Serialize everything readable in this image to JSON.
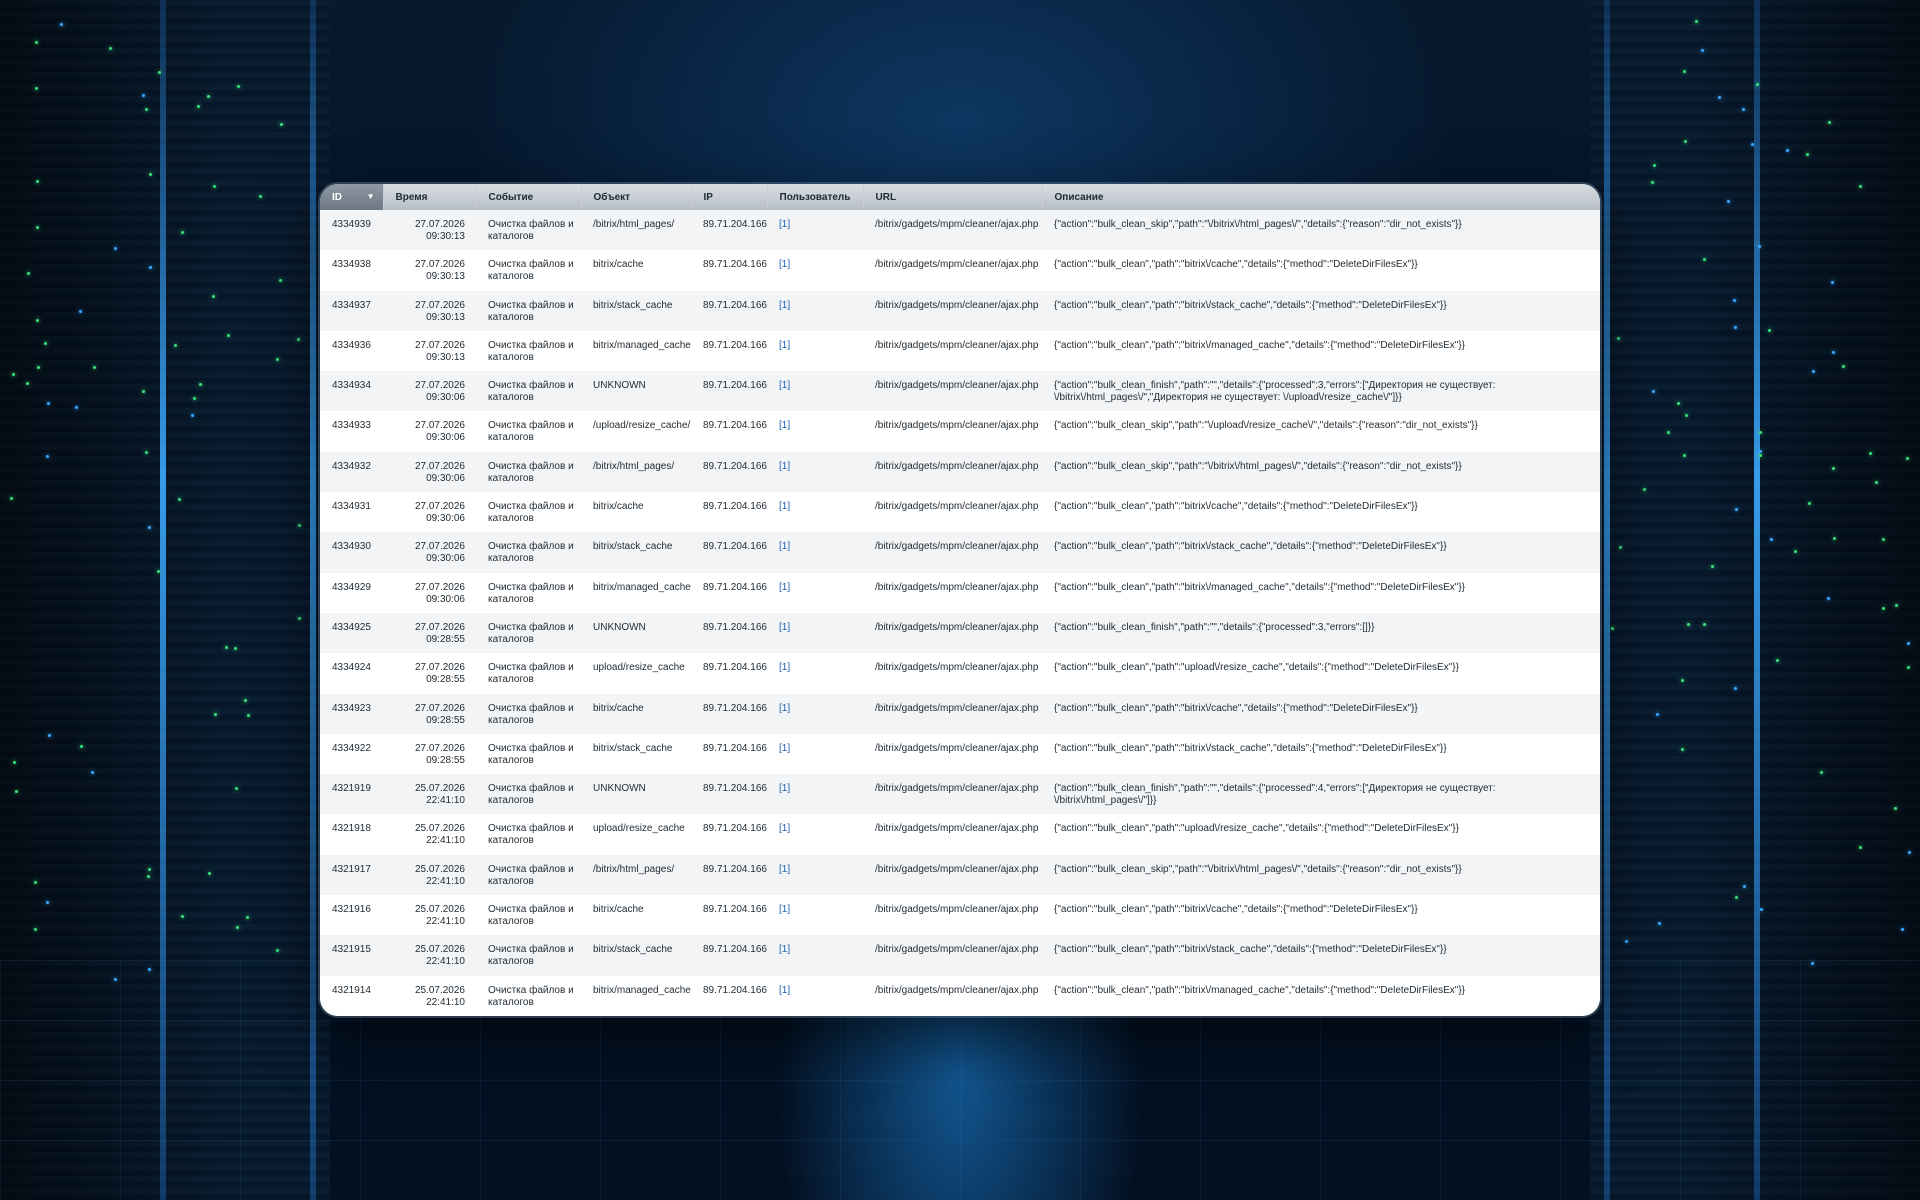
{
  "table": {
    "columns": [
      {
        "key": "id",
        "label": "ID",
        "sorted": true
      },
      {
        "key": "time",
        "label": "Время"
      },
      {
        "key": "event",
        "label": "Событие"
      },
      {
        "key": "object",
        "label": "Объект"
      },
      {
        "key": "ip",
        "label": "IP"
      },
      {
        "key": "user",
        "label": "Пользователь"
      },
      {
        "key": "url",
        "label": "URL"
      },
      {
        "key": "desc",
        "label": "Описание"
      }
    ],
    "sort_icon": "sort-desc-icon",
    "rows": [
      {
        "id": "4334939",
        "date": "27.07.2026",
        "clock": "09:30:13",
        "event": "Очистка файлов и каталогов",
        "object": "/bitrix/html_pages/",
        "ip": "89.71.204.166",
        "user": "[1]",
        "url": "/bitrix/gadgets/mpm/cleaner/ajax.php",
        "desc": "{\"action\":\"bulk_clean_skip\",\"path\":\"\\/bitrix\\/html_pages\\/\",\"details\":{\"reason\":\"dir_not_exists\"}}"
      },
      {
        "id": "4334938",
        "date": "27.07.2026",
        "clock": "09:30:13",
        "event": "Очистка файлов и каталогов",
        "object": "bitrix/cache",
        "ip": "89.71.204.166",
        "user": "[1]",
        "url": "/bitrix/gadgets/mpm/cleaner/ajax.php",
        "desc": "{\"action\":\"bulk_clean\",\"path\":\"bitrix\\/cache\",\"details\":{\"method\":\"DeleteDirFilesEx\"}}"
      },
      {
        "id": "4334937",
        "date": "27.07.2026",
        "clock": "09:30:13",
        "event": "Очистка файлов и каталогов",
        "object": "bitrix/stack_cache",
        "ip": "89.71.204.166",
        "user": "[1]",
        "url": "/bitrix/gadgets/mpm/cleaner/ajax.php",
        "desc": "{\"action\":\"bulk_clean\",\"path\":\"bitrix\\/stack_cache\",\"details\":{\"method\":\"DeleteDirFilesEx\"}}"
      },
      {
        "id": "4334936",
        "date": "27.07.2026",
        "clock": "09:30:13",
        "event": "Очистка файлов и каталогов",
        "object": "bitrix/managed_cache",
        "ip": "89.71.204.166",
        "user": "[1]",
        "url": "/bitrix/gadgets/mpm/cleaner/ajax.php",
        "desc": "{\"action\":\"bulk_clean\",\"path\":\"bitrix\\/managed_cache\",\"details\":{\"method\":\"DeleteDirFilesEx\"}}"
      },
      {
        "id": "4334934",
        "date": "27.07.2026",
        "clock": "09:30:06",
        "event": "Очистка файлов и каталогов",
        "object": "UNKNOWN",
        "ip": "89.71.204.166",
        "user": "[1]",
        "url": "/bitrix/gadgets/mpm/cleaner/ajax.php",
        "desc": "{\"action\":\"bulk_clean_finish\",\"path\":\"\",\"details\":{\"processed\":3,\"errors\":[\"Директория не существует: \\/bitrix\\/html_pages\\/\",\"Директория не существует: \\/upload\\/resize_cache\\/\"]}}"
      },
      {
        "id": "4334933",
        "date": "27.07.2026",
        "clock": "09:30:06",
        "event": "Очистка файлов и каталогов",
        "object": "/upload/resize_cache/",
        "ip": "89.71.204.166",
        "user": "[1]",
        "url": "/bitrix/gadgets/mpm/cleaner/ajax.php",
        "desc": "{\"action\":\"bulk_clean_skip\",\"path\":\"\\/upload\\/resize_cache\\/\",\"details\":{\"reason\":\"dir_not_exists\"}}"
      },
      {
        "id": "4334932",
        "date": "27.07.2026",
        "clock": "09:30:06",
        "event": "Очистка файлов и каталогов",
        "object": "/bitrix/html_pages/",
        "ip": "89.71.204.166",
        "user": "[1]",
        "url": "/bitrix/gadgets/mpm/cleaner/ajax.php",
        "desc": "{\"action\":\"bulk_clean_skip\",\"path\":\"\\/bitrix\\/html_pages\\/\",\"details\":{\"reason\":\"dir_not_exists\"}}"
      },
      {
        "id": "4334931",
        "date": "27.07.2026",
        "clock": "09:30:06",
        "event": "Очистка файлов и каталогов",
        "object": "bitrix/cache",
        "ip": "89.71.204.166",
        "user": "[1]",
        "url": "/bitrix/gadgets/mpm/cleaner/ajax.php",
        "desc": "{\"action\":\"bulk_clean\",\"path\":\"bitrix\\/cache\",\"details\":{\"method\":\"DeleteDirFilesEx\"}}"
      },
      {
        "id": "4334930",
        "date": "27.07.2026",
        "clock": "09:30:06",
        "event": "Очистка файлов и каталогов",
        "object": "bitrix/stack_cache",
        "ip": "89.71.204.166",
        "user": "[1]",
        "url": "/bitrix/gadgets/mpm/cleaner/ajax.php",
        "desc": "{\"action\":\"bulk_clean\",\"path\":\"bitrix\\/stack_cache\",\"details\":{\"method\":\"DeleteDirFilesEx\"}}"
      },
      {
        "id": "4334929",
        "date": "27.07.2026",
        "clock": "09:30:06",
        "event": "Очистка файлов и каталогов",
        "object": "bitrix/managed_cache",
        "ip": "89.71.204.166",
        "user": "[1]",
        "url": "/bitrix/gadgets/mpm/cleaner/ajax.php",
        "desc": "{\"action\":\"bulk_clean\",\"path\":\"bitrix\\/managed_cache\",\"details\":{\"method\":\"DeleteDirFilesEx\"}}"
      },
      {
        "id": "4334925",
        "date": "27.07.2026",
        "clock": "09:28:55",
        "event": "Очистка файлов и каталогов",
        "object": "UNKNOWN",
        "ip": "89.71.204.166",
        "user": "[1]",
        "url": "/bitrix/gadgets/mpm/cleaner/ajax.php",
        "desc": "{\"action\":\"bulk_clean_finish\",\"path\":\"\",\"details\":{\"processed\":3,\"errors\":[]}}"
      },
      {
        "id": "4334924",
        "date": "27.07.2026",
        "clock": "09:28:55",
        "event": "Очистка файлов и каталогов",
        "object": "upload/resize_cache",
        "ip": "89.71.204.166",
        "user": "[1]",
        "url": "/bitrix/gadgets/mpm/cleaner/ajax.php",
        "desc": "{\"action\":\"bulk_clean\",\"path\":\"upload\\/resize_cache\",\"details\":{\"method\":\"DeleteDirFilesEx\"}}"
      },
      {
        "id": "4334923",
        "date": "27.07.2026",
        "clock": "09:28:55",
        "event": "Очистка файлов и каталогов",
        "object": "bitrix/cache",
        "ip": "89.71.204.166",
        "user": "[1]",
        "url": "/bitrix/gadgets/mpm/cleaner/ajax.php",
        "desc": "{\"action\":\"bulk_clean\",\"path\":\"bitrix\\/cache\",\"details\":{\"method\":\"DeleteDirFilesEx\"}}"
      },
      {
        "id": "4334922",
        "date": "27.07.2026",
        "clock": "09:28:55",
        "event": "Очистка файлов и каталогов",
        "object": "bitrix/stack_cache",
        "ip": "89.71.204.166",
        "user": "[1]",
        "url": "/bitrix/gadgets/mpm/cleaner/ajax.php",
        "desc": "{\"action\":\"bulk_clean\",\"path\":\"bitrix\\/stack_cache\",\"details\":{\"method\":\"DeleteDirFilesEx\"}}"
      },
      {
        "id": "4321919",
        "date": "25.07.2026",
        "clock": "22:41:10",
        "event": "Очистка файлов и каталогов",
        "object": "UNKNOWN",
        "ip": "89.71.204.166",
        "user": "[1]",
        "url": "/bitrix/gadgets/mpm/cleaner/ajax.php",
        "desc": "{\"action\":\"bulk_clean_finish\",\"path\":\"\",\"details\":{\"processed\":4,\"errors\":[\"Директория не существует: \\/bitrix\\/html_pages\\/\"]}}"
      },
      {
        "id": "4321918",
        "date": "25.07.2026",
        "clock": "22:41:10",
        "event": "Очистка файлов и каталогов",
        "object": "upload/resize_cache",
        "ip": "89.71.204.166",
        "user": "[1]",
        "url": "/bitrix/gadgets/mpm/cleaner/ajax.php",
        "desc": "{\"action\":\"bulk_clean\",\"path\":\"upload\\/resize_cache\",\"details\":{\"method\":\"DeleteDirFilesEx\"}}"
      },
      {
        "id": "4321917",
        "date": "25.07.2026",
        "clock": "22:41:10",
        "event": "Очистка файлов и каталогов",
        "object": "/bitrix/html_pages/",
        "ip": "89.71.204.166",
        "user": "[1]",
        "url": "/bitrix/gadgets/mpm/cleaner/ajax.php",
        "desc": "{\"action\":\"bulk_clean_skip\",\"path\":\"\\/bitrix\\/html_pages\\/\",\"details\":{\"reason\":\"dir_not_exists\"}}"
      },
      {
        "id": "4321916",
        "date": "25.07.2026",
        "clock": "22:41:10",
        "event": "Очистка файлов и каталогов",
        "object": "bitrix/cache",
        "ip": "89.71.204.166",
        "user": "[1]",
        "url": "/bitrix/gadgets/mpm/cleaner/ajax.php",
        "desc": "{\"action\":\"bulk_clean\",\"path\":\"bitrix\\/cache\",\"details\":{\"method\":\"DeleteDirFilesEx\"}}"
      },
      {
        "id": "4321915",
        "date": "25.07.2026",
        "clock": "22:41:10",
        "event": "Очистка файлов и каталогов",
        "object": "bitrix/stack_cache",
        "ip": "89.71.204.166",
        "user": "[1]",
        "url": "/bitrix/gadgets/mpm/cleaner/ajax.php",
        "desc": "{\"action\":\"bulk_clean\",\"path\":\"bitrix\\/stack_cache\",\"details\":{\"method\":\"DeleteDirFilesEx\"}}"
      },
      {
        "id": "4321914",
        "date": "25.07.2026",
        "clock": "22:41:10",
        "event": "Очистка файлов и каталогов",
        "object": "bitrix/managed_cache",
        "ip": "89.71.204.166",
        "user": "[1]",
        "url": "/bitrix/gadgets/mpm/cleaner/ajax.php",
        "desc": "{\"action\":\"bulk_clean\",\"path\":\"bitrix\\/managed_cache\",\"details\":{\"method\":\"DeleteDirFilesEx\"}}"
      }
    ]
  }
}
